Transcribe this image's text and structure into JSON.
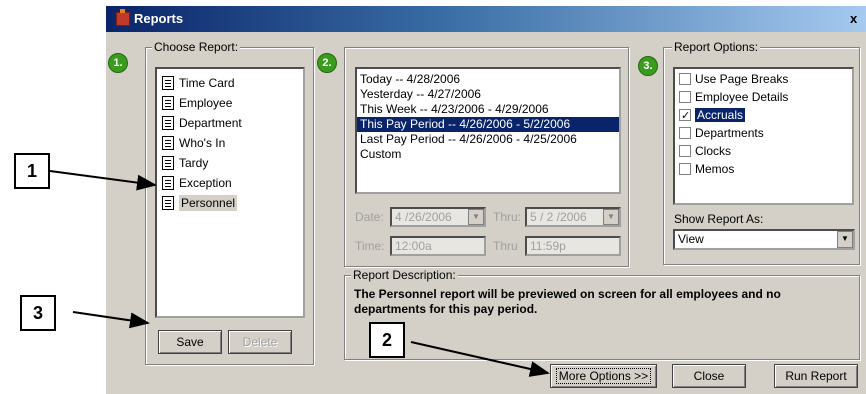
{
  "window": {
    "title": "Reports",
    "close_glyph": "x"
  },
  "steps": [
    "1.",
    "2.",
    "3."
  ],
  "choose_report": {
    "legend": "Choose Report:",
    "items": [
      {
        "label": "Time Card",
        "icon": "document-icon"
      },
      {
        "label": "Employee",
        "icon": "document-icon"
      },
      {
        "label": "Department",
        "icon": "document-icon"
      },
      {
        "label": "Who's In",
        "icon": "document-icon"
      },
      {
        "label": "Tardy",
        "icon": "document-icon"
      },
      {
        "label": "Exception",
        "icon": "document-icon"
      },
      {
        "label": "Personnel",
        "icon": "document-icon",
        "selected": true
      }
    ],
    "save_label": "Save",
    "delete_label": "Delete"
  },
  "period": {
    "items": [
      {
        "label": "Today -- 4/28/2006"
      },
      {
        "label": "Yesterday -- 4/27/2006"
      },
      {
        "label": "This Week -- 4/23/2006 - 4/29/2006"
      },
      {
        "label": "This Pay Period -- 4/26/2006 - 5/2/2006",
        "selected": true
      },
      {
        "label": "Last Pay Period -- 4/26/2006 - 4/25/2006"
      },
      {
        "label": "Custom"
      }
    ],
    "date_label": "Date:",
    "date_value": "4 /26/2006",
    "thru_label": "Thru:",
    "thru_value": "5 / 2 /2006",
    "time_label": "Time:",
    "time_value": "12:00a",
    "thru2_label": "Thru",
    "thru2_value": "11:59p"
  },
  "report_options": {
    "legend": "Report Options:",
    "items": [
      {
        "label": "Use Page Breaks",
        "checked": false
      },
      {
        "label": "Employee Details",
        "checked": false
      },
      {
        "label": "Accruals",
        "checked": true,
        "selected": true
      },
      {
        "label": "Departments",
        "checked": false
      },
      {
        "label": "Clocks",
        "checked": false
      },
      {
        "label": "Memos",
        "checked": false
      }
    ],
    "show_as_label": "Show Report As:",
    "show_as_value": "View"
  },
  "description": {
    "legend": "Report Description:",
    "text": "The Personnel report will be previewed on screen for all employees and no departments for this pay period."
  },
  "buttons": {
    "more_options": "More Options >>",
    "close": "Close",
    "run_report": "Run Report"
  },
  "callouts": [
    "1",
    "2",
    "3"
  ]
}
